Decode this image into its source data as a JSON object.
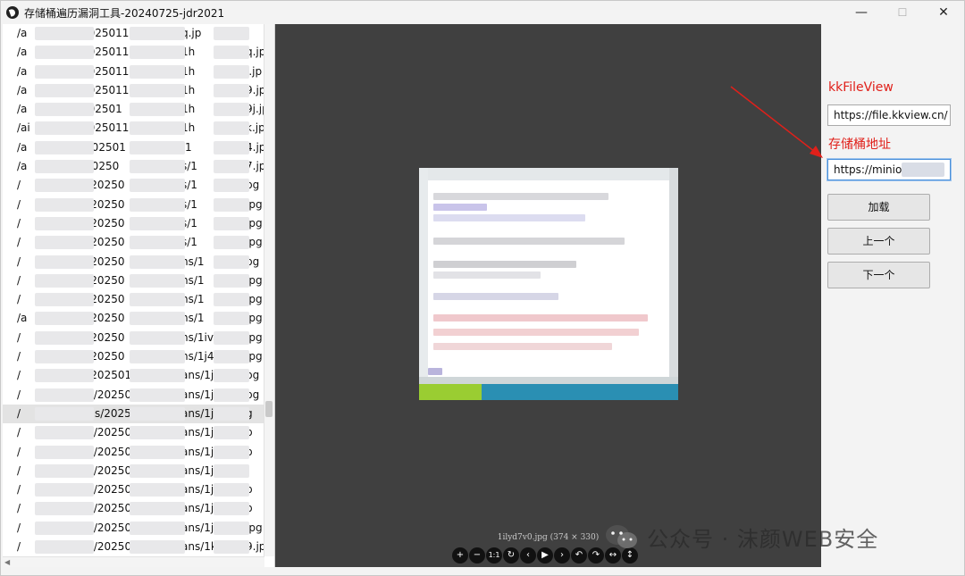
{
  "window": {
    "title": "存储桶遍历漏洞工具-20240725-jdr2021",
    "minimize_glyph": "—",
    "maximize_glyph": "☐",
    "close_glyph": "✕",
    "app_icon": "app-logo-icon"
  },
  "file_list": {
    "items": [
      {
        "p1": "/a",
        "p2": "2025011",
        "p3": "q.jp"
      },
      {
        "p1": "/a",
        "p2": "2025011",
        "p3": "1h",
        "p4": "q.jp"
      },
      {
        "p1": "/a",
        "p2": "2025011",
        "p3": "1h",
        "p4": "j.jp"
      },
      {
        "p1": "/a",
        "p2": "2025011",
        "p3": "1h",
        "p4": "9.jp"
      },
      {
        "p1": "/a",
        "p2": "202501",
        "p3": "1h",
        "p4": "9j.jp"
      },
      {
        "p1": "/ai",
        "p2": "2025011",
        "p3": "1h",
        "p4": "k.jp"
      },
      {
        "p1": "/a",
        "p2": "/202501",
        "p3": "/1",
        "p4": "4.jp"
      },
      {
        "p1": "/a",
        "p2": "/20250",
        "p3": "s/1",
        "p4": "7.jp"
      },
      {
        "p1": "/",
        "p2": "s/20250",
        "p3": "s/1",
        "p4": "pg"
      },
      {
        "p1": "/",
        "p2": "s/20250",
        "p3": "s/1",
        "p4": "jpg"
      },
      {
        "p1": "/",
        "p2": "s/20250",
        "p3": "s/1",
        "p4": "jpg"
      },
      {
        "p1": "/",
        "p2": "s/20250",
        "p3": "s/1",
        "p4": "jpg"
      },
      {
        "p1": "/",
        "p2": "s/20250",
        "p3": "ns/1",
        "p4": "pg"
      },
      {
        "p1": "/",
        "p2": "s/20250",
        "p3": "ns/1",
        "p4": "jpg"
      },
      {
        "p1": "/",
        "p2": "s/20250",
        "p3": "ns/1",
        "p4": "jpg"
      },
      {
        "p1": "/a",
        "p2": "s/20250",
        "p3": "ns/1",
        "p4": "jpg"
      },
      {
        "p1": "/",
        "p2": "s/20250",
        "p3": "ns/1iv",
        "p4": "jpg"
      },
      {
        "p1": "/",
        "p2": "s/20250",
        "p3": "ns/1j4",
        "p4": "jpg"
      },
      {
        "p1": "/",
        "p2": "s/202501",
        "p3": "ans/1jb",
        "p4": "pg"
      },
      {
        "p1": "/",
        "p2": "ns/202501",
        "p3": "ans/1jfu",
        "p4": "pg"
      },
      {
        "p1": "/",
        "p2": "ans/2025011",
        "p3": "ans/1jly",
        "p4": "g"
      },
      {
        "p1": "/",
        "p2": "ns/2025011",
        "p3": "ans/1jn",
        "p4": "p"
      },
      {
        "p1": "/",
        "p2": "ns/2025011",
        "p3": "ans/1jrv",
        "p4": "p"
      },
      {
        "p1": "/",
        "p2": "ns/2025011",
        "p3": "ans/1ju",
        "p4": ""
      },
      {
        "p1": "/",
        "p2": "ns/2025011",
        "p3": "ans/1jw",
        "p4": "p"
      },
      {
        "p1": "/",
        "p2": "ns/2025011",
        "p3": "ans/1jx",
        "p4": "p"
      },
      {
        "p1": "/",
        "p2": "ns/2025011",
        "p3": "ans/1jx",
        "p4": "jpg"
      },
      {
        "p1": "/",
        "p2": "ns/202501",
        "p3": "ans/1k",
        "p4": "9.jpg"
      }
    ],
    "selected_index": 20
  },
  "viewer": {
    "caption": "1ilyd7v0.jpg (374 × 330)",
    "toolbar": [
      "+",
      "−",
      "1:1",
      "↻",
      "‹",
      "▶",
      "›",
      "↶",
      "↷",
      "↔",
      "↕"
    ]
  },
  "side_panel": {
    "kkfileview_label": "kkFileView",
    "kkfileview_value": "https://file.kkview.cn/",
    "bucket_label": "存储桶地址",
    "bucket_value": "https://minio-",
    "load_button": "加载",
    "prev_button": "上一个",
    "next_button": "下一个"
  },
  "watermark": {
    "text": "公众号 · 沫颜WEB安全"
  },
  "colors": {
    "annotation_red": "#e0201a",
    "viewer_bg": "#404040",
    "selected_row": "#e3e3e3"
  }
}
